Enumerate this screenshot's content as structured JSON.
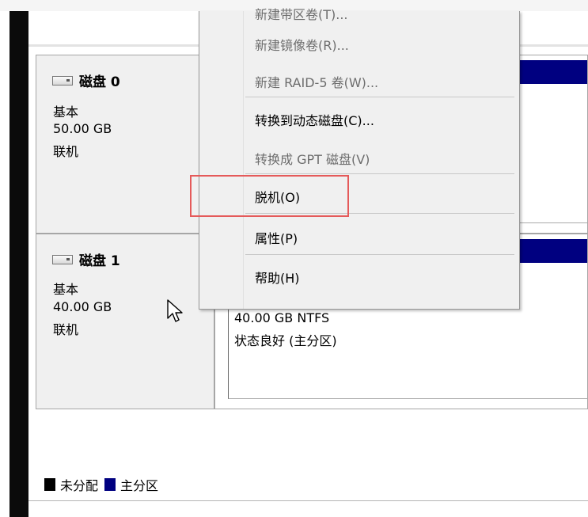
{
  "context_menu": {
    "items": [
      {
        "label": "新建带区卷(T)...",
        "enabled": false
      },
      {
        "label": "新建镜像卷(R)...",
        "enabled": false
      },
      {
        "label": "新建 RAID-5 卷(W)...",
        "enabled": false
      },
      {
        "label": "转换到动态磁盘(C)...",
        "enabled": true
      },
      {
        "label": "转换成 GPT 磁盘(V)",
        "enabled": false
      },
      {
        "label": "脱机(O)",
        "enabled": true,
        "highlighted": true
      },
      {
        "label": "属性(P)",
        "enabled": true
      },
      {
        "label": "帮助(H)",
        "enabled": true
      }
    ]
  },
  "disks": [
    {
      "name": "磁盘 0",
      "type": "基本",
      "size": "50.00 GB",
      "status": "联机"
    },
    {
      "name": "磁盘 1",
      "type": "基本",
      "size": "40.00 GB",
      "status": "联机",
      "partition": {
        "size_fs": "40.00 GB NTFS",
        "health": "状态良好 (主分区)"
      }
    }
  ],
  "legend": {
    "unallocated": {
      "label": "未分配",
      "color": "#000000"
    },
    "primary": {
      "label": "主分区",
      "color": "#000080"
    }
  },
  "colors": {
    "partition_bar": "#000080",
    "highlight_box": "#e55a5a"
  }
}
